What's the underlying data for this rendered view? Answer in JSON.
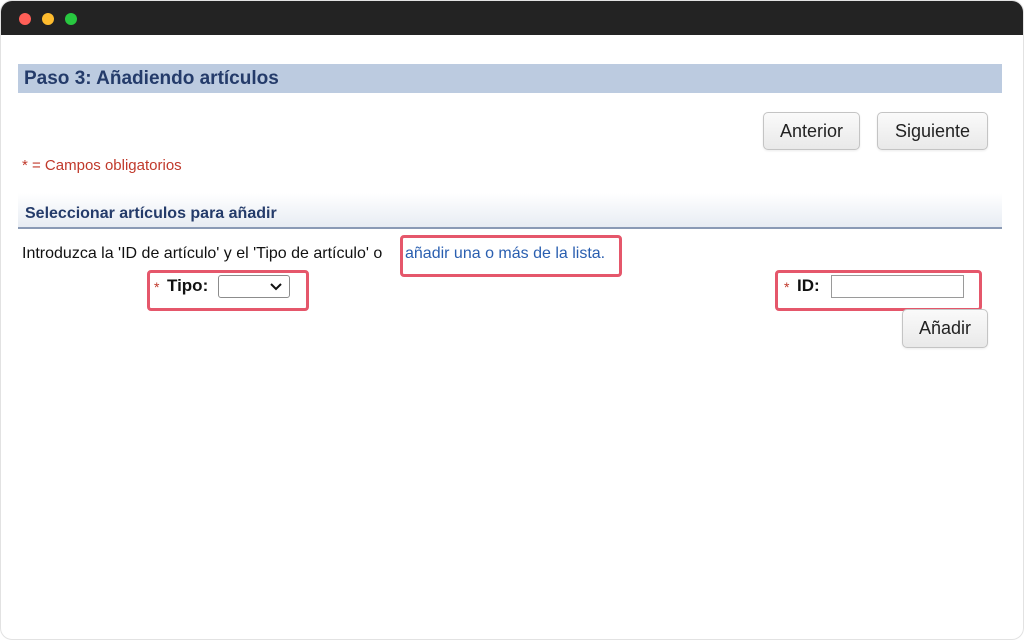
{
  "window": {
    "controls": [
      "close",
      "minimize",
      "maximize"
    ]
  },
  "step": {
    "title": "Paso 3: Añadiendo artículos"
  },
  "nav": {
    "prev_label": "Anterior",
    "next_label": "Siguiente"
  },
  "required_note": "* = Campos obligatorios",
  "section": {
    "title": "Seleccionar artículos para añadir",
    "intro": "Introduzca la 'ID de artículo' y el 'Tipo de artículo' o",
    "link": "añadir una o más de la lista."
  },
  "form": {
    "required_marker": "*",
    "tipo_label": "Tipo:",
    "tipo_value": "",
    "id_label": "ID:",
    "id_value": "",
    "add_label": "Añadir"
  },
  "colors": {
    "highlight": "#e5576b",
    "header_bg": "#bccbe0",
    "header_text": "#243b6a",
    "required": "#c0392b",
    "link": "#2a5fb0"
  }
}
